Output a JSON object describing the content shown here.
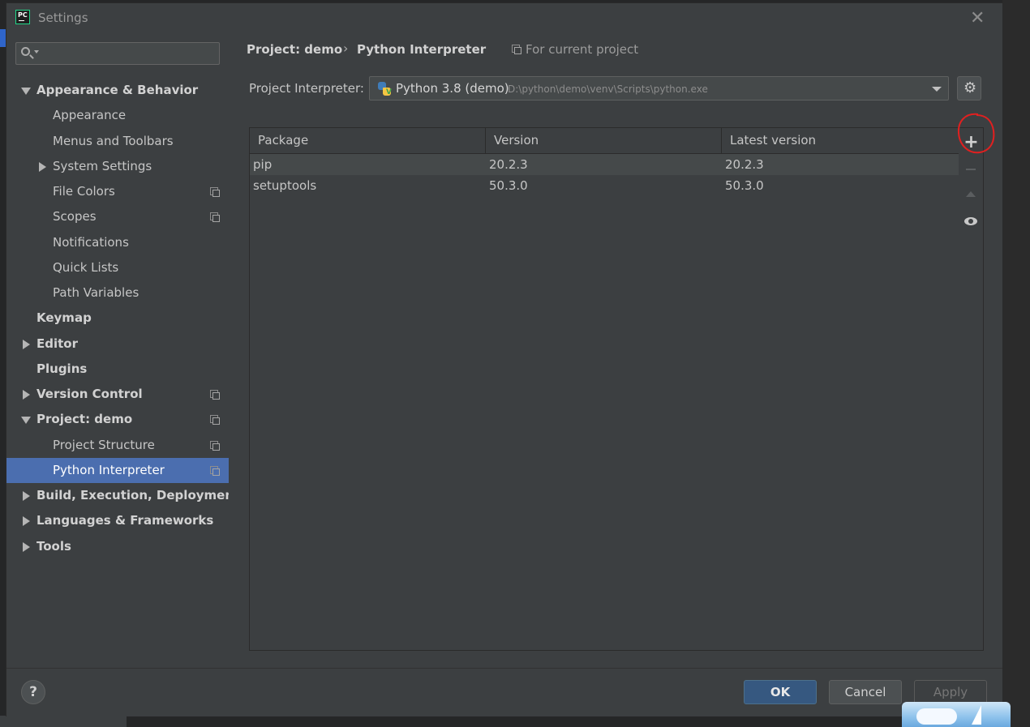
{
  "window": {
    "title": "Settings"
  },
  "sidebar": {
    "search_placeholder": "",
    "items": [
      {
        "label": "Appearance & Behavior",
        "level": 0,
        "bold": true,
        "arrow": "down",
        "project_icon": false,
        "selected": false
      },
      {
        "label": "Appearance",
        "level": 1,
        "bold": false,
        "arrow": "none",
        "project_icon": false,
        "selected": false
      },
      {
        "label": "Menus and Toolbars",
        "level": 1,
        "bold": false,
        "arrow": "none",
        "project_icon": false,
        "selected": false
      },
      {
        "label": "System Settings",
        "level": 1,
        "bold": false,
        "arrow": "right",
        "project_icon": false,
        "selected": false
      },
      {
        "label": "File Colors",
        "level": 1,
        "bold": false,
        "arrow": "none",
        "project_icon": true,
        "selected": false
      },
      {
        "label": "Scopes",
        "level": 1,
        "bold": false,
        "arrow": "none",
        "project_icon": true,
        "selected": false
      },
      {
        "label": "Notifications",
        "level": 1,
        "bold": false,
        "arrow": "none",
        "project_icon": false,
        "selected": false
      },
      {
        "label": "Quick Lists",
        "level": 1,
        "bold": false,
        "arrow": "none",
        "project_icon": false,
        "selected": false
      },
      {
        "label": "Path Variables",
        "level": 1,
        "bold": false,
        "arrow": "none",
        "project_icon": false,
        "selected": false
      },
      {
        "label": "Keymap",
        "level": 0,
        "bold": true,
        "arrow": "none",
        "project_icon": false,
        "selected": false
      },
      {
        "label": "Editor",
        "level": 0,
        "bold": true,
        "arrow": "right",
        "project_icon": false,
        "selected": false
      },
      {
        "label": "Plugins",
        "level": 0,
        "bold": true,
        "arrow": "none",
        "project_icon": false,
        "selected": false
      },
      {
        "label": "Version Control",
        "level": 0,
        "bold": true,
        "arrow": "right",
        "project_icon": true,
        "selected": false
      },
      {
        "label": "Project: demo",
        "level": 0,
        "bold": true,
        "arrow": "down",
        "project_icon": true,
        "selected": false
      },
      {
        "label": "Project Structure",
        "level": 1,
        "bold": false,
        "arrow": "none",
        "project_icon": true,
        "selected": false
      },
      {
        "label": "Python Interpreter",
        "level": 1,
        "bold": false,
        "arrow": "none",
        "project_icon": true,
        "selected": true
      },
      {
        "label": "Build, Execution, Deployment",
        "level": 0,
        "bold": true,
        "arrow": "right",
        "project_icon": false,
        "selected": false
      },
      {
        "label": "Languages & Frameworks",
        "level": 0,
        "bold": true,
        "arrow": "right",
        "project_icon": false,
        "selected": false
      },
      {
        "label": "Tools",
        "level": 0,
        "bold": true,
        "arrow": "right",
        "project_icon": false,
        "selected": false
      }
    ]
  },
  "breadcrumb": {
    "project": "Project: demo",
    "separator": "›",
    "page": "Python Interpreter",
    "scope_note": "For current project"
  },
  "interpreter": {
    "label": "Project Interpreter:",
    "name": "Python 3.8 (demo)",
    "path": "D:\\python\\demo\\venv\\Scripts\\python.exe"
  },
  "packages": {
    "columns": [
      "Package",
      "Version",
      "Latest version"
    ],
    "rows": [
      {
        "package": "pip",
        "version": "20.2.3",
        "latest": "20.2.3"
      },
      {
        "package": "setuptools",
        "version": "50.3.0",
        "latest": "50.3.0"
      }
    ]
  },
  "toolbar": {
    "add": "+",
    "remove_icon": "minus-icon",
    "upgrade_icon": "arrow-up-icon",
    "show_early_icon": "eye-icon"
  },
  "buttons": {
    "help": "?",
    "ok": "OK",
    "cancel": "Cancel",
    "apply": "Apply"
  },
  "colors": {
    "selection": "#4b6eaf",
    "ok_button": "#365880",
    "annotation": "#e02020"
  }
}
